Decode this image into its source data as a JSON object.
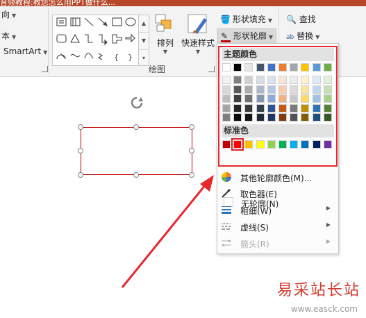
{
  "title": {
    "text": "音频教程:教您怎么用PPT做什么..."
  },
  "ribbon": {
    "left_items": [
      "向",
      "本",
      "SmartArt"
    ],
    "arrange_label": "排列",
    "quick_styles_label": "快速样式",
    "shape_fill_label": "形状填充",
    "shape_outline_label": "形状轮廓",
    "find_label": "查找",
    "replace_label": "替换",
    "drawing_group_label": "绘图"
  },
  "menu": {
    "theme_colors_title": "主题颜色",
    "theme_top_row": [
      "#ffffff",
      "#000000",
      "#e7e6e6",
      "#44546a",
      "#4472c4",
      "#ed7d31",
      "#a5a5a5",
      "#ffc000",
      "#5b9bd5",
      "#70ad47"
    ],
    "theme_shades": [
      [
        "#f2f2f2",
        "#7f7f7f",
        "#d0cece",
        "#d6dce4",
        "#d9e2f3",
        "#fbe5d5",
        "#ededed",
        "#fff2cc",
        "#ddebf7",
        "#e2efd9"
      ],
      [
        "#d8d8d8",
        "#595959",
        "#aeabab",
        "#adb9ca",
        "#b4c6e7",
        "#f7cbac",
        "#dbdbdb",
        "#fee599",
        "#bdd7ee",
        "#c5e0b3"
      ],
      [
        "#bfbfbf",
        "#3f3f3f",
        "#757070",
        "#8496b0",
        "#8eaadb",
        "#f4b183",
        "#c9c9c9",
        "#ffd965",
        "#9cc3e5",
        "#a8d08d"
      ],
      [
        "#a5a5a5",
        "#262626",
        "#3a3838",
        "#323f4f",
        "#2f5496",
        "#c55a11",
        "#7b7b7b",
        "#bf9000",
        "#2e75b5",
        "#538135"
      ],
      [
        "#7f7f7f",
        "#0c0c0c",
        "#171616",
        "#222a35",
        "#1f3864",
        "#833c0b",
        "#525252",
        "#7f6000",
        "#1f4e79",
        "#375623"
      ]
    ],
    "standard_colors_title": "标准色",
    "standard_colors": [
      "#c00000",
      "#ff0000",
      "#ffc000",
      "#ffff00",
      "#92d050",
      "#00b050",
      "#00b0f0",
      "#0070c0",
      "#002060",
      "#7030a0"
    ],
    "no_outline_label": "无轮廓(N)",
    "items": [
      {
        "label": "其他轮廓颜色(M)...",
        "icon": "color-wheel-icon"
      },
      {
        "label": "取色器(E)",
        "icon": "eyedropper-icon"
      },
      {
        "label": "粗细(W)",
        "icon": "line-weight-icon"
      },
      {
        "label": "虚线(S)",
        "icon": "dash-line-icon"
      },
      {
        "label": "箭头(R)",
        "icon": "arrows-icon"
      }
    ]
  },
  "watermark": {
    "brand": "易采站长站",
    "url": "www.easck.com"
  },
  "colors": {
    "accent_red": "#e8262c",
    "selection_red": "#c00000"
  }
}
